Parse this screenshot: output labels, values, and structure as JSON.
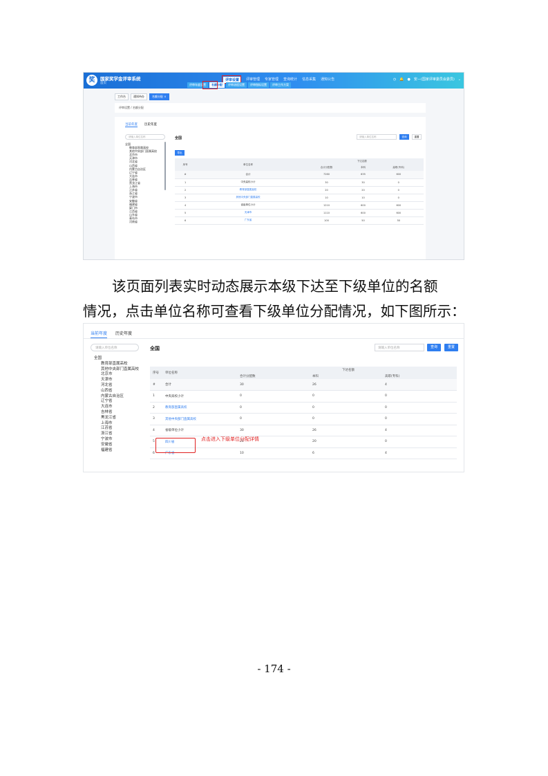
{
  "screenshot1": {
    "header": {
      "title": "国家奖学金评审系统",
      "subtitle": "首页",
      "nav": [
        "评审设置",
        "评审管理",
        "专家管理",
        "查询统计",
        "信息采集",
        "通知公告"
      ],
      "subnav": [
        "评审年度设置",
        "名额分配",
        "评审流程设置",
        "评审指标设置",
        "评审工作方案"
      ],
      "user": "安—(国家评审委员会委员)"
    },
    "toptabs": [
      "工作台",
      "通知待办",
      "名额分配 ×"
    ],
    "breadcrumb": "评审设置 / 名额分配",
    "year_tabs": [
      "当前年度",
      "历史年度"
    ],
    "tree_search_placeholder": "请输入单位名称",
    "tree_items": [
      "全国",
      "教育部直属高校",
      "其他中央部门直属高校",
      "北京市",
      "天津市",
      "河北省",
      "山西省",
      "内蒙古自治区",
      "辽宁省",
      "大连市",
      "吉林省",
      "黑龙江省",
      "上海市",
      "江苏省",
      "浙江省",
      "宁波市",
      "安徽省",
      "福建省",
      "厦门市",
      "江西省",
      "山东省",
      "青岛市",
      "河南省"
    ],
    "region": "全国",
    "search_placeholder": "请输入单位名称",
    "query_label": "查询",
    "reset_label": "重置",
    "export_label": "导出",
    "table": {
      "headers": [
        "序号",
        "单位名称",
        "下达名额",
        "合计分配数",
        "本科",
        "高职(专科)"
      ],
      "rows": [
        [
          "#",
          "合计",
          "7260",
          "635",
          "600"
        ],
        [
          "1",
          "中央高校小计",
          "30",
          "30",
          "0"
        ],
        [
          "2",
          "教育部直属高校",
          "20",
          "20",
          "0"
        ],
        [
          "3",
          "其他中央部门直属高校",
          "10",
          "10",
          "0"
        ],
        [
          "4",
          "省级单位小计",
          "1210",
          "600",
          "600"
        ],
        [
          "5",
          "天津市",
          "1110",
          "600",
          "600"
        ],
        [
          "6",
          "广东省",
          "100",
          "50",
          "50"
        ]
      ]
    }
  },
  "paragraph": {
    "line1": "该页面列表实时动态展示本级下达至下级单位的名额",
    "line2": "情况，点击单位名称可查看下级单位分配情况，如下图所示："
  },
  "screenshot2": {
    "year_tabs": [
      "当前年度",
      "历史年度"
    ],
    "tree_search_placeholder": "请输入单位名称",
    "tree_items": [
      "全国",
      "教育部直属高校",
      "其他中央部门直属高校",
      "北京市",
      "天津市",
      "河北省",
      "山西省",
      "内蒙古自治区",
      "辽宁省",
      "大连市",
      "吉林省",
      "黑龙江省",
      "上海市",
      "江苏省",
      "浙江省",
      "宁波市",
      "安徽省",
      "福建省"
    ],
    "region": "全国",
    "search_placeholder": "请输入单位名称",
    "query_label": "查询",
    "reset_label": "重置",
    "table": {
      "headers": [
        "序号",
        "单位名称",
        "下达名额",
        "合计分配数",
        "本科",
        "高职(专科)"
      ],
      "rows": [
        [
          "#",
          "合计",
          "30",
          "26",
          "4"
        ],
        [
          "1",
          "中央高校小计",
          "0",
          "0",
          "0"
        ],
        [
          "2",
          "教育部直属高校",
          "0",
          "0",
          "0"
        ],
        [
          "3",
          "其他中央部门直属高校",
          "0",
          "0",
          "0"
        ],
        [
          "4",
          "省级单位小计",
          "30",
          "26",
          "4"
        ],
        [
          "5",
          "四川省",
          "20",
          "20",
          "0"
        ],
        [
          "6",
          "广东省",
          "10",
          "6",
          "4"
        ]
      ]
    },
    "annotation": "点击进入下级单位分配详情"
  },
  "page_number": "- 174 -"
}
